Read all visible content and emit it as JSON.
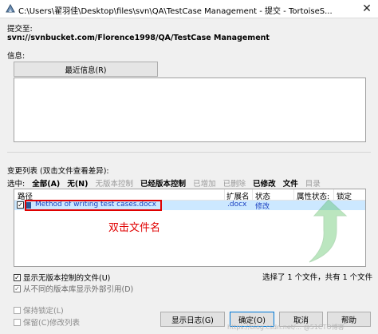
{
  "window": {
    "title": "C:\\Users\\翟羽佳\\Desktop\\files\\svn\\QA\\TestCase Management - 提交 - TortoiseS...",
    "close_glyph": "✕"
  },
  "commit": {
    "url_label": "提交至:",
    "url": "svn://svnbucket.com/Florence1998/QA/TestCase Management",
    "message_label": "信息:",
    "recent_button": "最近信息(R)",
    "message_value": ""
  },
  "changes": {
    "label": "变更列表 (双击文件查看差异):",
    "select_label": "选中:",
    "filters": [
      {
        "label": "全部(A)",
        "enabled": true
      },
      {
        "label": "无(N)",
        "enabled": true
      },
      {
        "label": "无版本控制",
        "enabled": false
      },
      {
        "label": "已经版本控制",
        "enabled": true
      },
      {
        "label": "已增加",
        "enabled": false
      },
      {
        "label": "已删除",
        "enabled": false
      },
      {
        "label": "已修改",
        "enabled": true
      },
      {
        "label": "文件",
        "enabled": true
      },
      {
        "label": "目录",
        "enabled": false
      }
    ],
    "columns": {
      "path": "路径",
      "ext": "扩展名",
      "status": "状态",
      "prop_status": "属性状态:",
      "lock": "锁定"
    },
    "rows": [
      {
        "checked": true,
        "path": "Method of writing test cases.docx",
        "ext": ".docx",
        "status": "修改"
      }
    ],
    "annotation": "双击文件名",
    "show_unversioned": "显示无版本控制的文件(U)",
    "exclude_externals": "从不同的版本库显示外部引用(D)",
    "status_summary": "选择了 1 个文件，共有 1 个文件"
  },
  "options": {
    "keep_locks": "保持锁定(L)",
    "keep_changelists": "保留(C)修改列表"
  },
  "buttons": {
    "show_log": "显示日志(G)",
    "ok": "确定(O)",
    "cancel": "取消",
    "help": "帮助"
  },
  "watermark": "https://blog.csdn.net/...  @51CTO博客",
  "colors": {
    "selection": "#cce8ff",
    "annotation": "#e00000",
    "arrow": "#3fb84a"
  }
}
